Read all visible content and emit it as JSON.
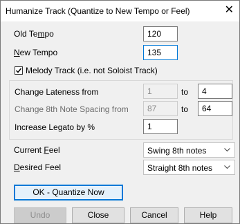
{
  "window": {
    "title": "Humanize Track (Quantize to New Tempo or Feel)",
    "close_glyph": "✕"
  },
  "tempo": {
    "old_label_pre": "Old Te",
    "old_label_u": "m",
    "old_label_post": "po",
    "old_value": "120",
    "new_label_u": "N",
    "new_label_post": "ew Tempo",
    "new_value": "135"
  },
  "melody_track": {
    "label": "Melody Track (i.e. not Soloist Track)",
    "checked": true
  },
  "adjust": {
    "lateness_label": "Change Lateness from",
    "lateness_from": "1",
    "lateness_to_label": "to",
    "lateness_to": "4",
    "spacing_label": "Change 8th Note Spacing from",
    "spacing_from": "87",
    "spacing_to_label": "to",
    "spacing_to": "64",
    "legato_label": "Increase Legato by %",
    "legato_value": "1"
  },
  "feel": {
    "current_label_pre": "Current ",
    "current_label_u": "F",
    "current_label_post": "eel",
    "current_value": "Swing 8th notes",
    "desired_label_u": "D",
    "desired_label_post": "esired Feel",
    "desired_value": "Straight 8th notes"
  },
  "buttons": {
    "ok": "OK - Quantize Now",
    "undo": "Undo",
    "close": "Close",
    "cancel": "Cancel",
    "help": "Help"
  },
  "colors": {
    "accent": "#0078d7"
  }
}
